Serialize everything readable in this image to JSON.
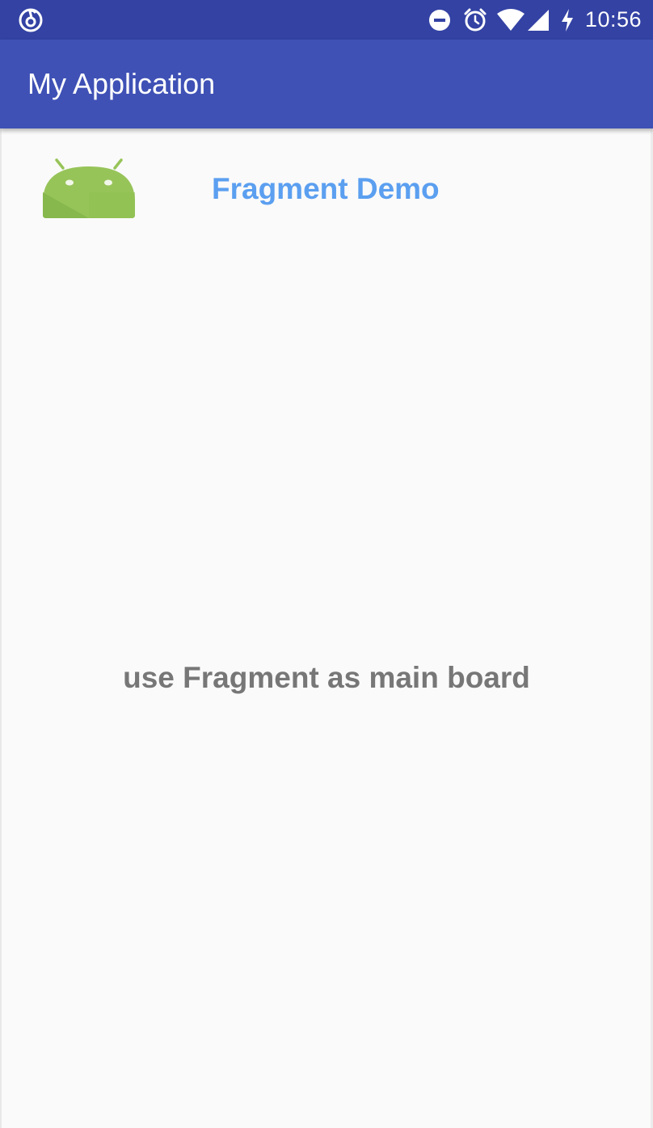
{
  "status_bar": {
    "time": "10:56",
    "left_icon": "netease-music-icon",
    "icons": [
      "do-not-disturb-icon",
      "alarm-icon",
      "wifi-icon",
      "cell-signal-icon",
      "charging-icon"
    ],
    "background_color": "#3342a3"
  },
  "app_bar": {
    "title": "My Application",
    "background_color": "#3f51b5"
  },
  "header": {
    "logo_icon": "android-icon",
    "title": "Fragment Demo",
    "title_color": "#5b9ff0"
  },
  "main": {
    "text": "use Fragment as main board",
    "text_color": "#777777"
  }
}
